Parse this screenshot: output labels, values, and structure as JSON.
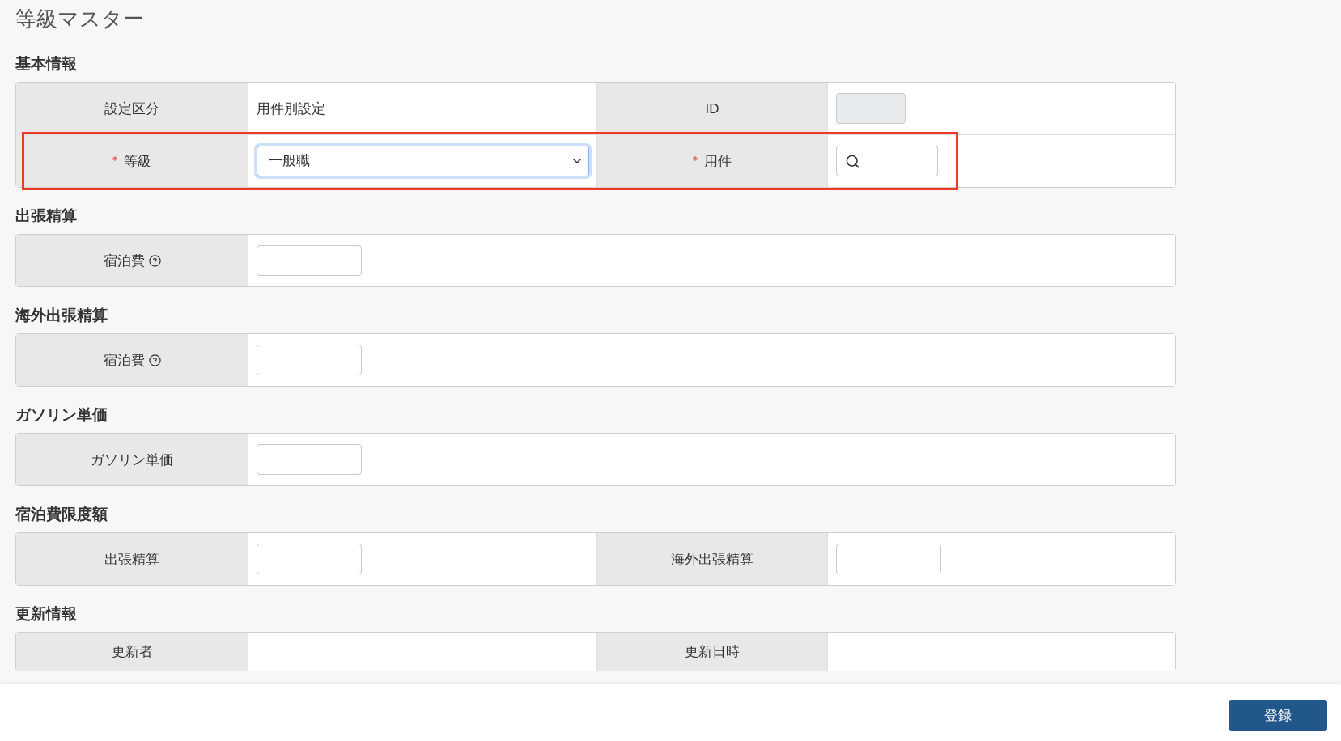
{
  "page": {
    "title": "等級マスター"
  },
  "sections": [
    {
      "heading": "基本情報",
      "rows": [
        {
          "highlighted": false,
          "pairs": [
            {
              "label": "設定区分",
              "required": false,
              "help": false,
              "field": {
                "kind": "text",
                "value": "用件別設定"
              }
            },
            {
              "label": "ID",
              "required": false,
              "help": false,
              "field": {
                "kind": "readonly"
              }
            }
          ]
        },
        {
          "highlighted": true,
          "pairs": [
            {
              "label": "等級",
              "required": true,
              "help": false,
              "field": {
                "kind": "select",
                "value": "一般職",
                "focused": true
              }
            },
            {
              "label": "用件",
              "required": true,
              "help": false,
              "field": {
                "kind": "search"
              }
            }
          ]
        }
      ]
    },
    {
      "heading": "出張精算",
      "rows": [
        {
          "highlighted": false,
          "pairs": [
            {
              "label": "宿泊費",
              "required": false,
              "help": true,
              "field": {
                "kind": "input"
              }
            }
          ]
        }
      ]
    },
    {
      "heading": "海外出張精算",
      "rows": [
        {
          "highlighted": false,
          "pairs": [
            {
              "label": "宿泊費",
              "required": false,
              "help": true,
              "field": {
                "kind": "input"
              }
            }
          ]
        }
      ]
    },
    {
      "heading": "ガソリン単価",
      "rows": [
        {
          "highlighted": false,
          "pairs": [
            {
              "label": "ガソリン単価",
              "required": false,
              "help": false,
              "field": {
                "kind": "input"
              }
            }
          ]
        }
      ]
    },
    {
      "heading": "宿泊費限度額",
      "rows": [
        {
          "highlighted": false,
          "pairs": [
            {
              "label": "出張精算",
              "required": false,
              "help": false,
              "field": {
                "kind": "input"
              }
            },
            {
              "label": "海外出張精算",
              "required": false,
              "help": false,
              "field": {
                "kind": "input"
              }
            }
          ]
        }
      ]
    },
    {
      "heading": "更新情報",
      "rows": [
        {
          "highlighted": false,
          "pairs": [
            {
              "label": "更新者",
              "required": false,
              "help": false,
              "field": {
                "kind": "text"
              }
            },
            {
              "label": "更新日時",
              "required": false,
              "help": false,
              "field": {
                "kind": "text"
              }
            }
          ]
        }
      ]
    }
  ],
  "footer": {
    "buttons": [
      {
        "label": "登録"
      }
    ]
  }
}
